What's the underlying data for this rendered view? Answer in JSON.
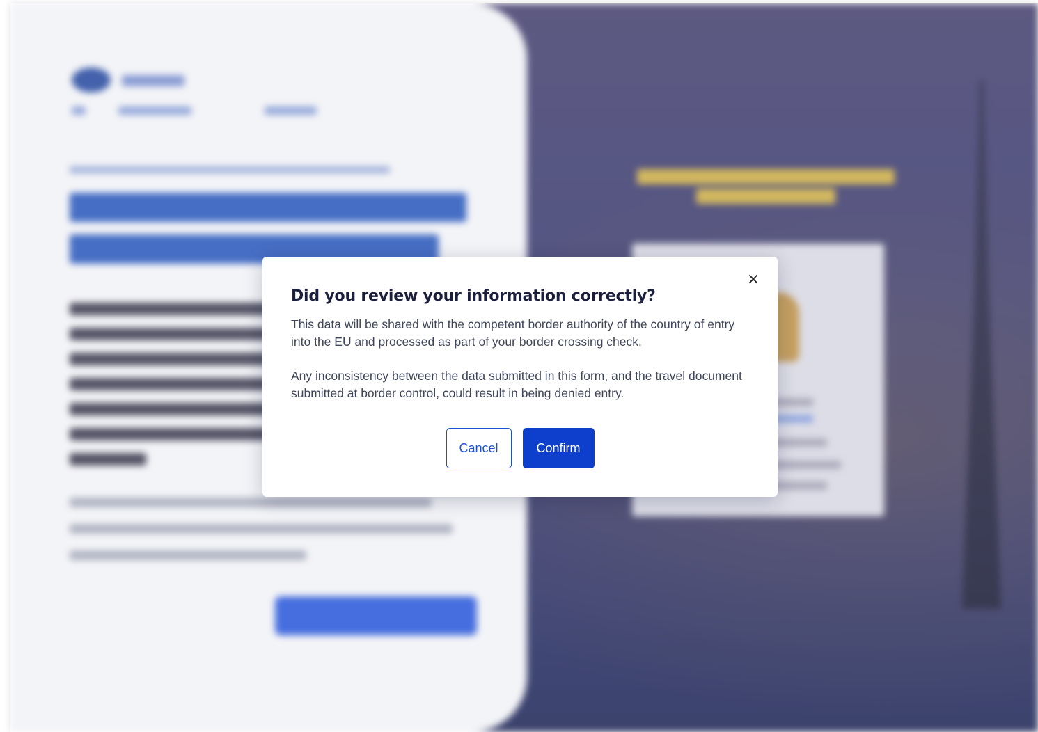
{
  "modal": {
    "title": "Did you review your information correctly?",
    "paragraph_1": "This data will be shared with the competent border authority of the country of entry into the EU and processed as part of your border crossing check.",
    "paragraph_2": "Any inconsistency between the data submitted in this form, and the travel document submitted at border control, could result in being denied entry.",
    "close_icon": "close-icon",
    "close_symbol": "×",
    "cancel_label": "Cancel",
    "confirm_label": "Confirm"
  },
  "colors": {
    "primary": "#0e3fcc",
    "title_text": "#1b1f3b",
    "body_text": "#40465a",
    "background_panel": "#2d2f69"
  }
}
